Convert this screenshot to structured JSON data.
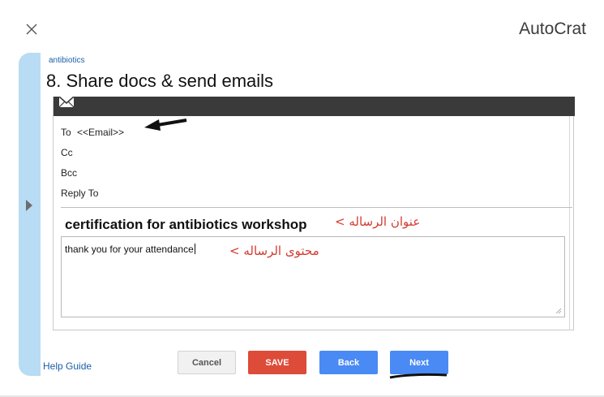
{
  "app": {
    "title": "AutoCrat"
  },
  "breadcrumb": "antibiotics",
  "step_title": "8. Share docs & send emails",
  "email": {
    "to_label": "To",
    "to_value": "<<Email>>",
    "cc_label": "Cc",
    "bcc_label": "Bcc",
    "reply_to_label": "Reply To",
    "subject": "certification for antibiotics workshop",
    "body": "thank you for your attendance"
  },
  "annotations": {
    "subject_note": "عنوان الرساله >",
    "body_note": "محتوى الرساله >"
  },
  "footer": {
    "help_link": "Help Guide",
    "cancel_label": "Cancel",
    "save_label": "SAVE",
    "back_label": "Back",
    "next_label": "Next"
  },
  "colors": {
    "sidebar": "#b7dcf3",
    "save": "#dd4b39",
    "primary": "#4a8af4",
    "annotation": "#d43a2f",
    "email_header": "#3a3a3a"
  },
  "icons": [
    "close-icon",
    "expand-arrow-icon",
    "mail-icon",
    "resize-grip-icon",
    "pointer-arrow-icon"
  ]
}
